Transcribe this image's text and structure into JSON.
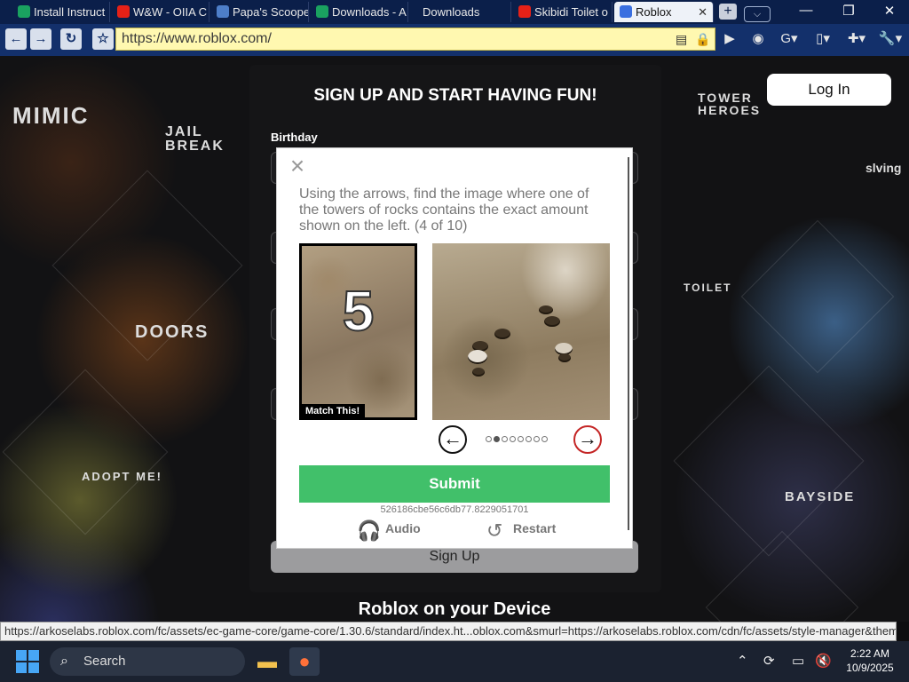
{
  "browser": {
    "tabs": [
      {
        "label": "Install Instruct",
        "favicon_color": "#1aa260"
      },
      {
        "label": "W&W - OIIA C",
        "favicon_color": "#e62117"
      },
      {
        "label": "Papa's Scoope",
        "favicon_color": "#4d7ec9"
      },
      {
        "label": "Downloads - A",
        "favicon_color": "#1aa260"
      },
      {
        "label": "Downloads",
        "favicon_color": "#0b1f4a"
      },
      {
        "label": "Skibidi Toilet o",
        "favicon_color": "#e62117"
      },
      {
        "label": "Roblox",
        "favicon_color": "#3a6fe0",
        "active": true
      }
    ],
    "tab_close_glyph": "✕",
    "new_tab_glyph": "+",
    "url": "https://www.roblox.com/"
  },
  "page": {
    "bg_labels": [
      "MIMIC",
      "JAIL BREAK",
      "DOORS",
      "TOWER HEROES",
      "ADOPT ME!",
      "TOILET",
      "BAYSIDE",
      "slving"
    ],
    "login_label": "Log In",
    "signup_title": "SIGN UP AND START HAVING FUN!",
    "birthday_label": "Birthday",
    "signup_button": "Sign Up",
    "device_heading": "Roblox on your Device"
  },
  "captcha": {
    "instruction": "Using the arrows, find the image where one of the towers of rocks contains the exact amount shown on the left. (4 of 10)",
    "reference_number": "5",
    "match_label": "Match This!",
    "submit_label": "Submit",
    "session_id": "526186cbe56c6db77.8229051701",
    "audio_label": "Audio",
    "restart_label": "Restart",
    "total_pages": 8,
    "current_page": 2,
    "submit_color": "#41c06a"
  },
  "status_url": "https://arkoselabs.roblox.com/fc/assets/ec-game-core/game-core/1.30.6/standard/index.ht...oblox.com&smurl=https://arkoselabs.roblox.com/cdn/fc/assets/style-manager&theme=modal#",
  "taskbar": {
    "search_label": "Search",
    "time": "2:22 AM",
    "date": "10/9/2025"
  }
}
